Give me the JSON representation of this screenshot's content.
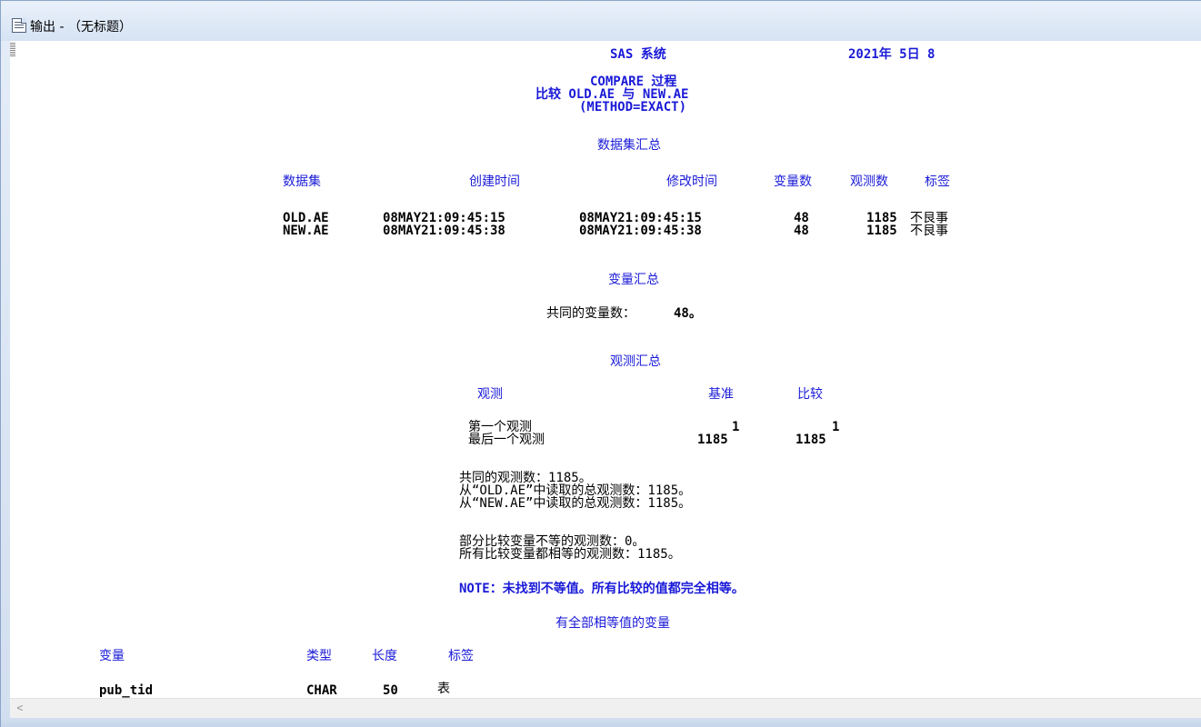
{
  "window": {
    "title": "输出 - （无标题）"
  },
  "report": {
    "system_title": "SAS 系统",
    "date_partial": "2021年 5日 8",
    "proc_title": "COMPARE 过程",
    "compare_line": "比较 OLD.AE 与 NEW.AE",
    "method_line": "(METHOD=EXACT)",
    "dataset_summary": {
      "title": "数据集汇总",
      "headers": [
        "数据集",
        "创建时间",
        "修改时间",
        "变量数",
        "观测数",
        "标签"
      ],
      "rows": [
        [
          "OLD.AE",
          "08MAY21:09:45:15",
          "08MAY21:09:45:15",
          "48",
          "1185",
          "不良事"
        ],
        [
          "NEW.AE",
          "08MAY21:09:45:38",
          "08MAY21:09:45:38",
          "48",
          "1185",
          "不良事"
        ]
      ]
    },
    "variable_summary": {
      "title": "变量汇总",
      "common_label": "共同的变量数：",
      "common_value": "48。"
    },
    "observation_summary": {
      "title": "观测汇总",
      "headers": [
        "观测",
        "基准",
        "比较"
      ],
      "rows": [
        [
          "第一个观测",
          "1",
          "1"
        ],
        [
          "最后一个观测",
          "1185",
          "1185"
        ]
      ],
      "common_obs": "共同的观测数：1185。",
      "read_old": "从“OLD.AE”中读取的总观测数：1185。",
      "read_new": "从“NEW.AE”中读取的总观测数：1185。",
      "unequal": "部分比较变量不等的观测数：0。",
      "all_equal": "所有比较变量都相等的观测数：1185。"
    },
    "note": "NOTE：未找到不等值。所有比较的值都完全相等。",
    "equal_vars": {
      "title": "有全部相等值的变量",
      "headers": [
        "变量",
        "类型",
        "长度",
        "标签"
      ],
      "rows": [
        [
          "pub_tid",
          "CHAR",
          "50",
          "表"
        ]
      ]
    }
  },
  "scrollbar": {
    "left_arrow": "<"
  }
}
